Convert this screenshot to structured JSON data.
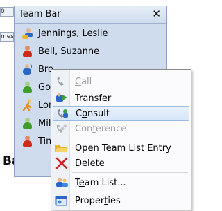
{
  "background": {
    "fragment_cells": [
      "0",
      "mes"
    ],
    "caption": "Bar"
  },
  "team_bar": {
    "title": "Team Bar",
    "close_glyph": "✕",
    "members": [
      {
        "name": "Jennings, Leslie",
        "icon": "person-blue-group-icon"
      },
      {
        "name": "Bell, Suzanne",
        "icon": "person-red-icon"
      },
      {
        "name": "Bro",
        "icon": "person-blue-speaking-icon"
      },
      {
        "name": "Goo",
        "icon": "person-green-icon"
      },
      {
        "name": "Lon",
        "icon": "person-orange-walking-icon"
      },
      {
        "name": "Mill",
        "icon": "person-green-icon"
      },
      {
        "name": "Tim",
        "icon": "person-red-icon"
      }
    ]
  },
  "context_menu": {
    "items": [
      {
        "label_pre": "",
        "accel": "C",
        "label_post": "all",
        "icon": "call-handset-icon",
        "disabled": true
      },
      {
        "label_pre": "",
        "accel": "T",
        "label_post": "ransfer",
        "icon": "transfer-icon",
        "disabled": false
      },
      {
        "label_pre": "C",
        "accel": "o",
        "label_post": "nsult",
        "icon": "consult-icon",
        "disabled": false,
        "highlighted": true
      },
      {
        "label_pre": "Con",
        "accel": "f",
        "label_post": "erence",
        "icon": "conference-icon",
        "disabled": true
      },
      {
        "label_pre": "Open Team L",
        "accel": "i",
        "label_post": "st Entry",
        "icon": "open-folder-icon",
        "disabled": false
      },
      {
        "label_pre": "",
        "accel": "D",
        "label_post": "elete",
        "icon": "delete-x-icon",
        "disabled": false
      },
      {
        "label_pre": "T",
        "accel": "e",
        "label_post": "am List...",
        "icon": "team-list-icon",
        "disabled": false
      },
      {
        "label_pre": "Proper",
        "accel": "t",
        "label_post": "ies",
        "icon": "properties-icon",
        "disabled": false
      }
    ]
  },
  "colors": {
    "panel_bg": "#cfdcee",
    "menu_highlight": "#d6e5f8",
    "delete_red": "#d42020"
  }
}
